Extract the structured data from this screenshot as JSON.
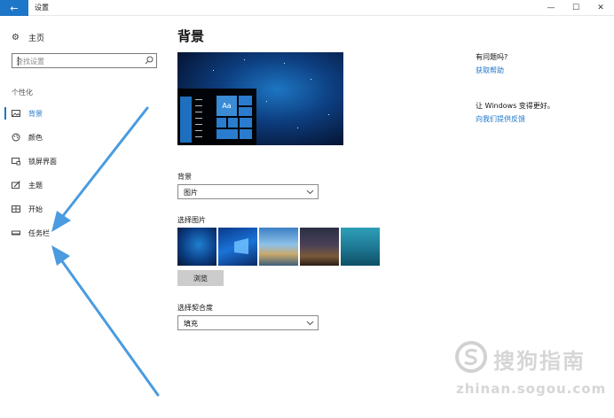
{
  "window": {
    "title": "设置",
    "back_icon": "arrow-left-icon",
    "controls": [
      "—",
      "☐",
      "✕"
    ]
  },
  "sidebar": {
    "home_label": "主页",
    "search_placeholder": "查找设置",
    "section_title": "个性化",
    "items": [
      {
        "label": "背景",
        "icon": "picture-icon",
        "active": true
      },
      {
        "label": "颜色",
        "icon": "palette-icon",
        "active": false
      },
      {
        "label": "锁屏界面",
        "icon": "lock-screen-icon",
        "active": false
      },
      {
        "label": "主题",
        "icon": "brush-icon",
        "active": false
      },
      {
        "label": "开始",
        "icon": "start-grid-icon",
        "active": false
      },
      {
        "label": "任务栏",
        "icon": "taskbar-icon",
        "active": false
      }
    ]
  },
  "main": {
    "title": "背景",
    "preview_tile_label": "Aa",
    "background_label": "背景",
    "background_value": "图片",
    "choose_picture_label": "选择图片",
    "browse_label": "浏览",
    "fit_label": "选择契合度",
    "fit_value": "填充"
  },
  "help": {
    "question": "有问题吗?",
    "get_help": "获取帮助",
    "improve": "让 Windows 变得更好。",
    "feedback": "向我们提供反馈"
  },
  "watermark": {
    "text": "搜狗指南",
    "url": "zhinan.sogou.com"
  },
  "colors": {
    "accent": "#1e76c8",
    "arrow": "#4a9be0"
  }
}
